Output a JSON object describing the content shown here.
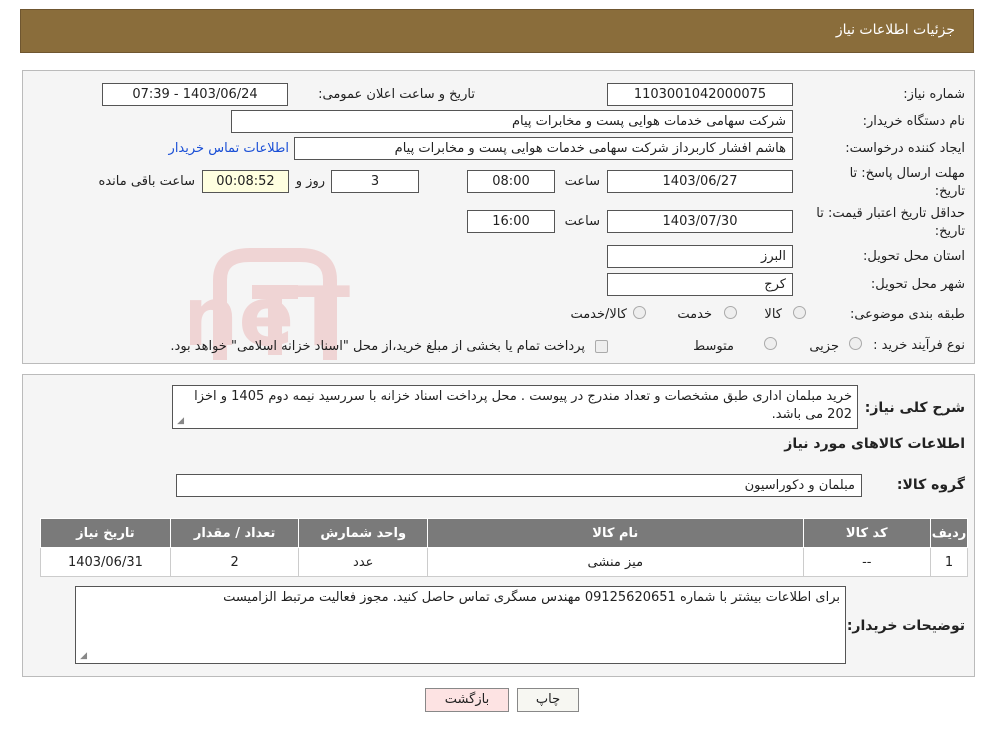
{
  "header": {
    "title": "جزئیات اطلاعات نیاز"
  },
  "watermark": {
    "text": "AriaTender.neT"
  },
  "form": {
    "need_number": {
      "label": "شماره نیاز:",
      "value": "1103001042000075"
    },
    "announce_datetime": {
      "label": "تاریخ و ساعت اعلان عمومی:",
      "value": "1403/06/24 - 07:39"
    },
    "buyer_org": {
      "label": "نام دستگاه خریدار:",
      "value": "شرکت سهامی خدمات هوایی پست و مخابرات پیام"
    },
    "requester": {
      "label": "ایجاد کننده درخواست:",
      "value": "هاشم افشار کاربرداز شرکت سهامی خدمات هوایی پست و مخابرات پیام",
      "contact_link": "اطلاعات تماس خریدار"
    },
    "reply_deadline": {
      "label": "مهلت ارسال پاسخ: تا تاریخ:",
      "date": "1403/06/27",
      "time_label": "ساعت",
      "time": "08:00",
      "days": "3",
      "days_label": "روز و",
      "remaining": "00:08:52",
      "remaining_label": "ساعت باقی مانده"
    },
    "price_validity": {
      "label": "حداقل تاریخ اعتبار قیمت: تا تاریخ:",
      "date": "1403/07/30",
      "time_label": "ساعت",
      "time": "16:00"
    },
    "province": {
      "label": "استان محل تحویل:",
      "value": "البرز"
    },
    "city": {
      "label": "شهر محل تحویل:",
      "value": "کرج"
    },
    "category": {
      "label": "طبقه بندی موضوعی:",
      "options": [
        "کالا",
        "خدمت",
        "کالا/خدمت"
      ]
    },
    "process_type": {
      "label": "نوع فرآیند خرید :",
      "options": [
        "جزیی",
        "متوسط"
      ],
      "note": "پرداخت تمام یا بخشی از مبلغ خرید،از محل \"اسناد خزانه اسلامی\" خواهد بود."
    }
  },
  "description": {
    "label": "شرح کلی نیاز:",
    "value": "خرید مبلمان اداری طبق مشخصات و تعداد مندرج در پیوست . محل پرداخت اسناد خزانه با سررسید نیمه دوم 1405 و اخزا 202 می باشد."
  },
  "goods": {
    "section_title": "اطلاعات کالاهای مورد نیاز",
    "group_label": "گروه کالا:",
    "group_value": "مبلمان و دکوراسیون",
    "table": {
      "headers": [
        "ردیف",
        "کد کالا",
        "نام کالا",
        "واحد شمارش",
        "تعداد / مقدار",
        "تاریخ نیاز"
      ],
      "rows": [
        [
          "1",
          "--",
          "میز منشی",
          "عدد",
          "2",
          "1403/06/31"
        ]
      ]
    }
  },
  "buyer_notes": {
    "label": "توضیحات خریدار:",
    "value": "برای اطلاعات بیشتر با شماره 09125620651 مهندس مسگری تماس حاصل کنید. مجوز فعالیت مرتبط الزامیست"
  },
  "buttons": {
    "print": "چاپ",
    "back": "بازگشت"
  }
}
